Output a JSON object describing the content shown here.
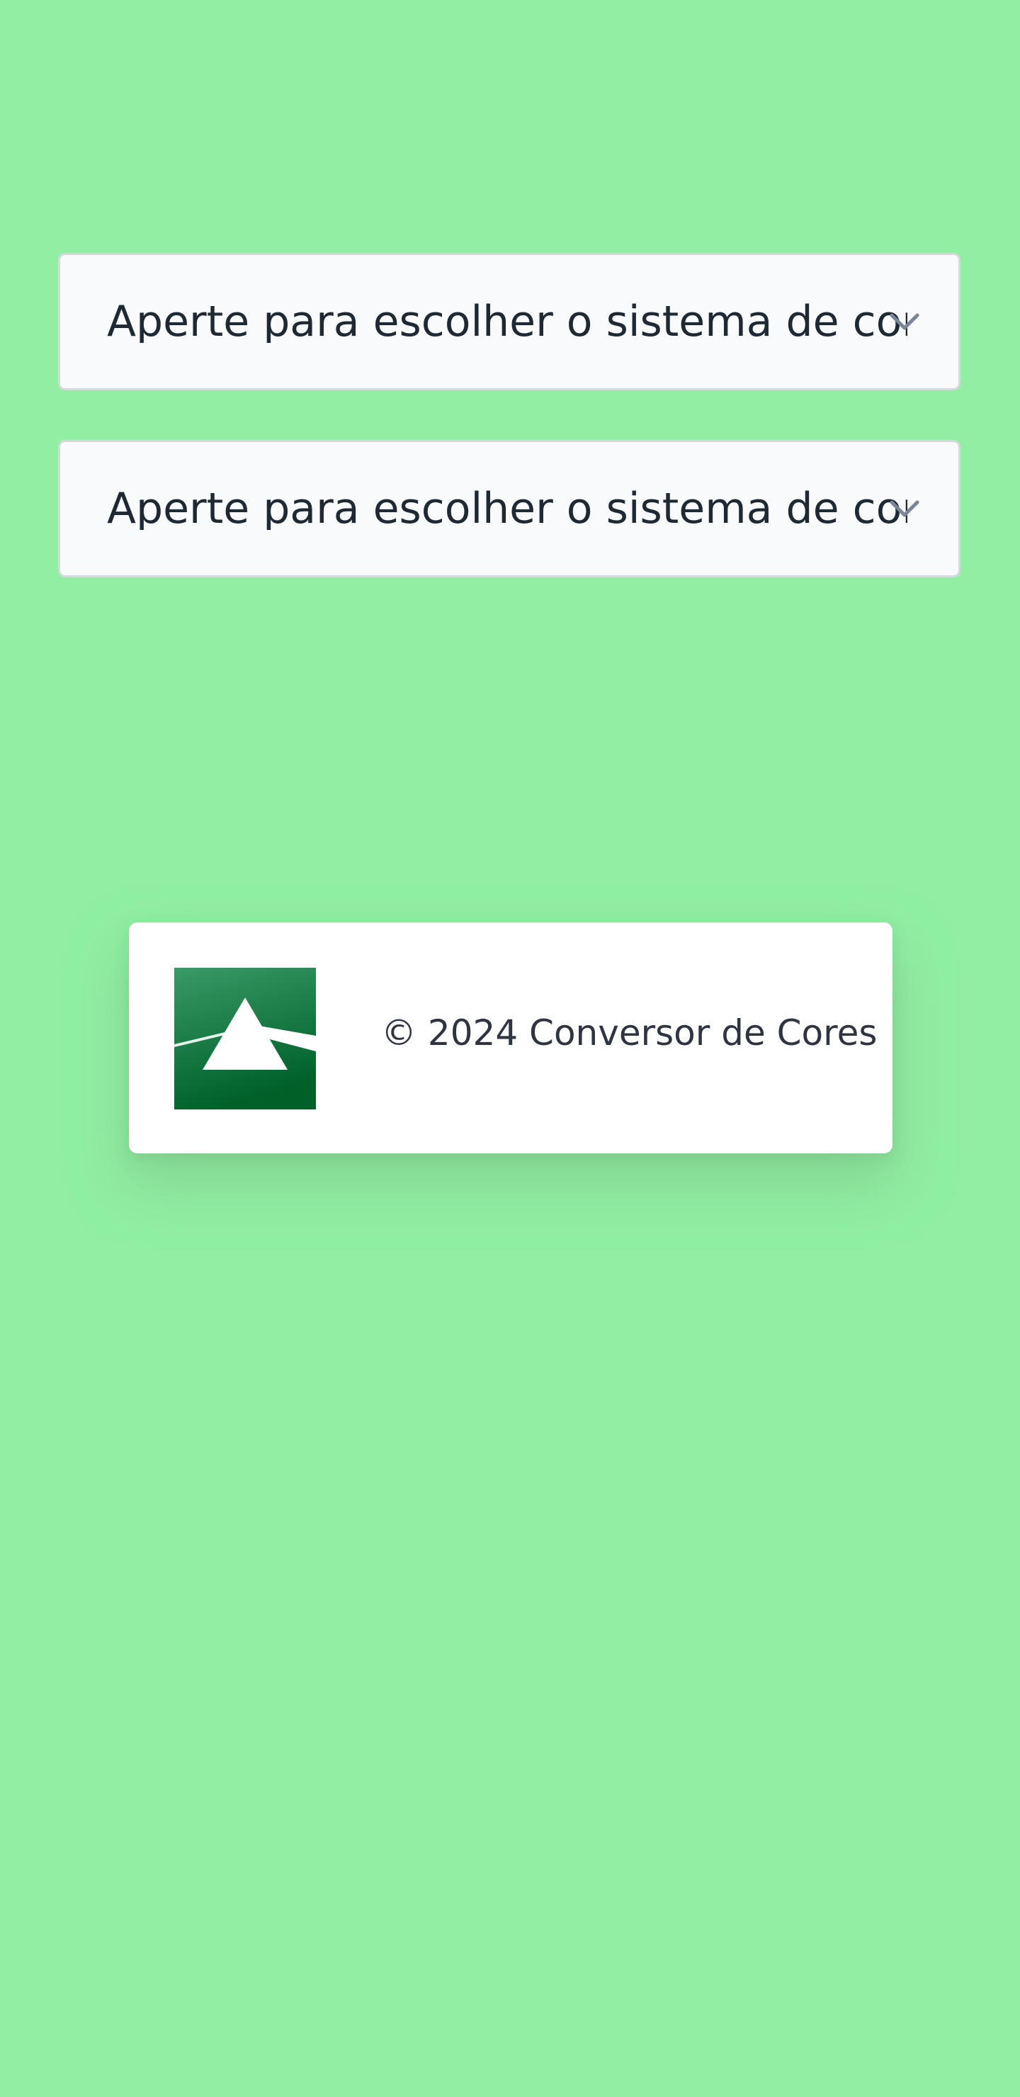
{
  "selects": [
    {
      "placeholder": "Aperte para escolher o sistema de cores"
    },
    {
      "placeholder": "Aperte para escolher o sistema de cores"
    }
  ],
  "icons": {
    "dropdown": "chevron-down-icon",
    "logo": "prism-logo"
  },
  "footer": {
    "copyright": "© 2024 Conversor de Cores"
  },
  "colors": {
    "background": "#90EFA2",
    "select_bg": "#F8FAFC",
    "logo_green": "#0A7A3A"
  }
}
